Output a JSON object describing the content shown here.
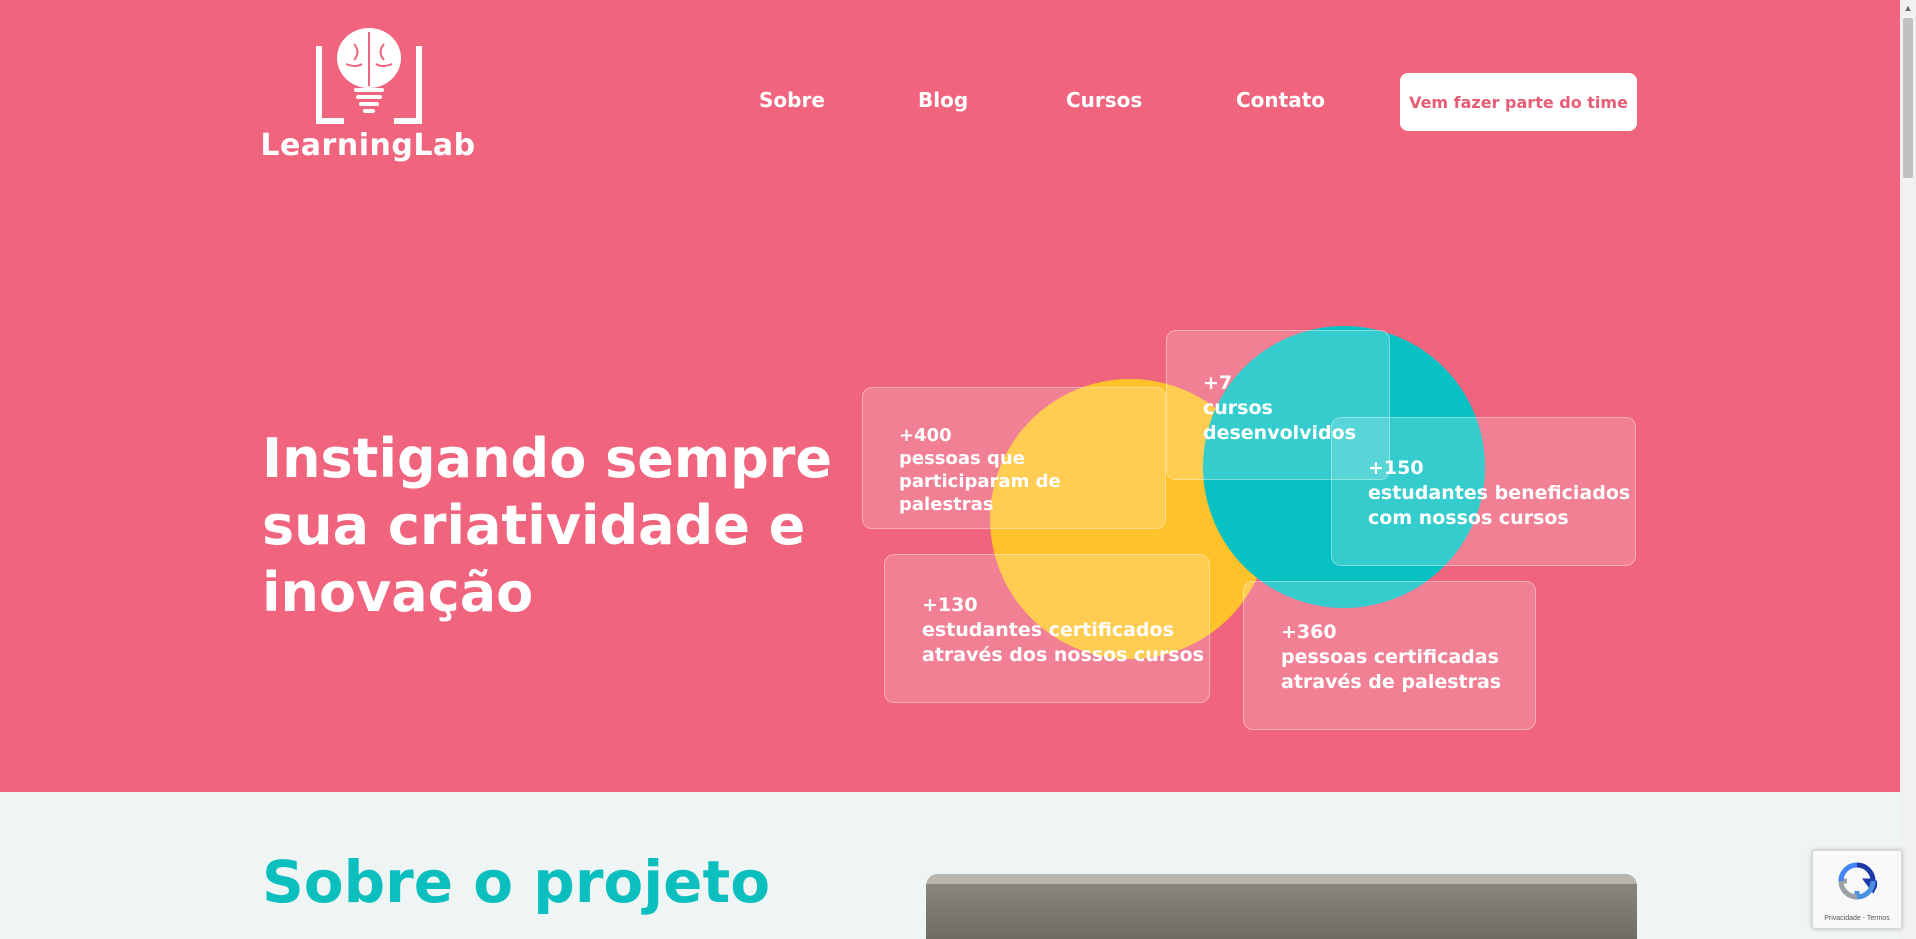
{
  "brand": {
    "name": "LearningLab"
  },
  "nav": {
    "items": [
      {
        "label": "Sobre"
      },
      {
        "label": "Blog"
      },
      {
        "label": "Cursos"
      },
      {
        "label": "Contato"
      }
    ],
    "cta_label": "Vem fazer parte do time"
  },
  "hero": {
    "headline": "Instigando sempre sua criatividade e inovação",
    "stats": [
      {
        "number": "+400",
        "text": "pessoas que participaram de palestras"
      },
      {
        "number": "+7",
        "text": "cursos desenvolvidos"
      },
      {
        "number": "+150",
        "text": "estudantes beneficiados com nossos cursos"
      },
      {
        "number": "+130",
        "text": "estudantes certificados através dos nossos cursos"
      },
      {
        "number": "+360",
        "text": "pessoas certificadas através de palestras"
      }
    ]
  },
  "about": {
    "title": "Sobre o projeto"
  },
  "recaptcha": {
    "label": "Privacidade - Termos",
    "icon": "recaptcha-icon"
  },
  "colors": {
    "hero_bg": "#f0647e",
    "accent_teal": "#08c1c2",
    "accent_yellow": "#ffc22b",
    "section_bg": "#eff4f4"
  }
}
